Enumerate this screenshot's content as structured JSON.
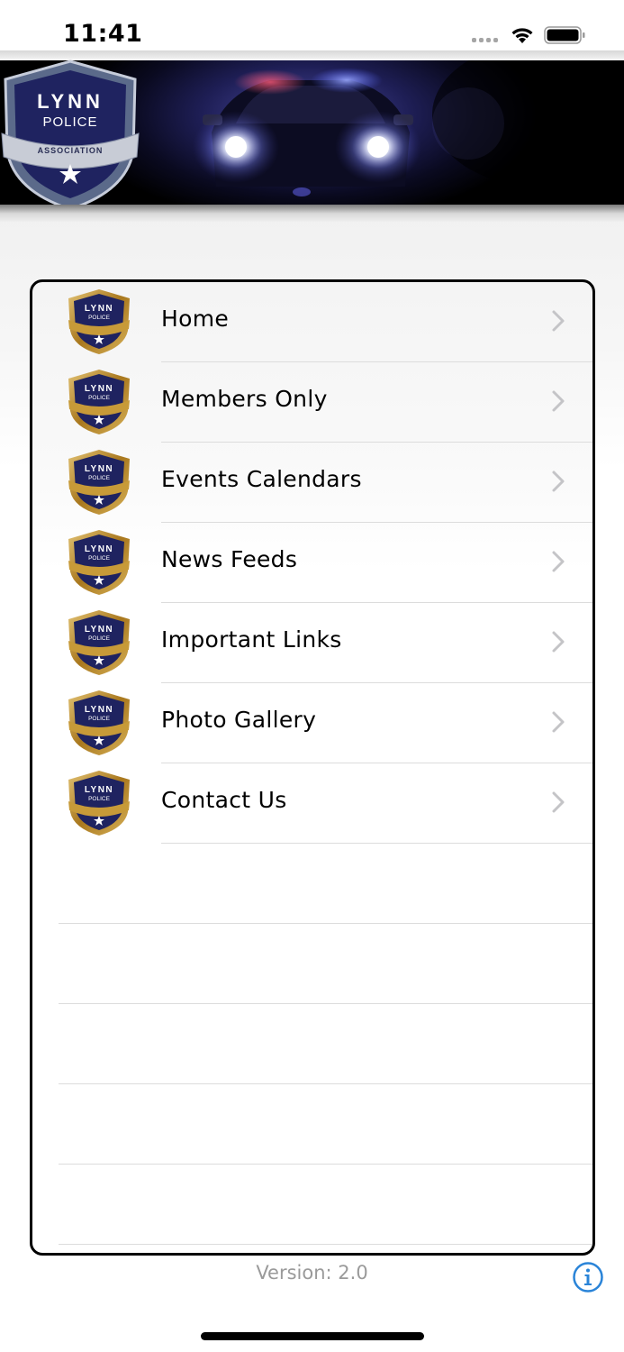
{
  "status_bar": {
    "time": "11:41",
    "icons": [
      "cellular-signal-icon",
      "wifi-icon",
      "battery-icon"
    ]
  },
  "banner": {
    "logo": {
      "name": "lynn-police-association-logo",
      "line1": "LYNN",
      "line2": "POLICE",
      "ribbon": "ASSOCIATION"
    },
    "image": "police-car-headlights"
  },
  "menu": {
    "items": [
      {
        "label": "Home",
        "icon": "police-badge-icon"
      },
      {
        "label": "Members Only",
        "icon": "police-badge-icon"
      },
      {
        "label": "Events Calendars",
        "icon": "police-badge-icon"
      },
      {
        "label": "News Feeds",
        "icon": "police-badge-icon"
      },
      {
        "label": "Important Links",
        "icon": "police-badge-icon"
      },
      {
        "label": "Photo Gallery",
        "icon": "police-badge-icon"
      },
      {
        "label": "Contact Us",
        "icon": "police-badge-icon"
      }
    ]
  },
  "footer": {
    "version": "Version: 2.0",
    "info_icon": "info-icon"
  },
  "colors": {
    "accent_blue": "#2a84d8",
    "badge_navy": "#1f2360",
    "badge_gold": "#b88a2a",
    "separator": "#dcdcdc"
  }
}
